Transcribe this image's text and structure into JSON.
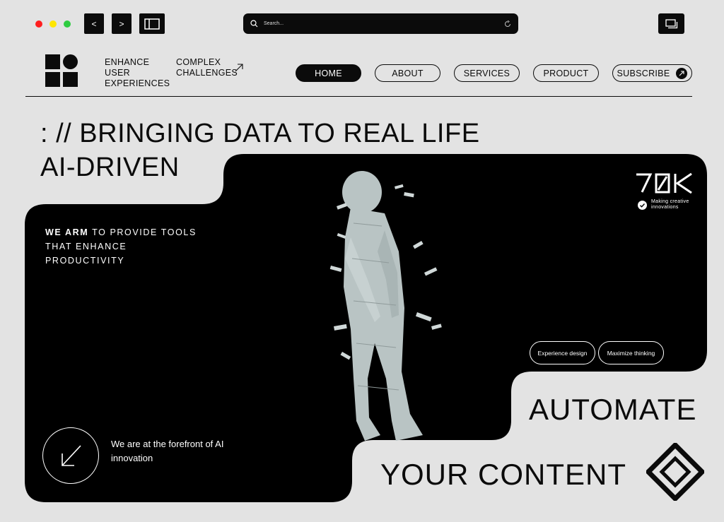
{
  "window": {
    "dots": [
      "#ff1f1f",
      "#ffe600",
      "#2ecc40"
    ],
    "back_label": "<",
    "forward_label": ">",
    "search_placeholder": "Search...",
    "icons": [
      "sidebar-icon",
      "search-icon",
      "reload-icon",
      "tabs-icon"
    ]
  },
  "header": {
    "tagline_1": [
      "ENHANCE",
      "USER",
      "EXPERIENCES"
    ],
    "tagline_2": [
      "COMPLEX",
      "CHALLENGES"
    ],
    "nav": [
      {
        "label": "HOME",
        "active": true
      },
      {
        "label": "ABOUT",
        "active": false
      },
      {
        "label": "SERVICES",
        "active": false
      },
      {
        "label": "PRODUCT",
        "active": false
      },
      {
        "label": "SUBSCRIBE",
        "active": false
      }
    ]
  },
  "hero": {
    "headline_1": ": //  BRINGING DATA TO REAL LIFE",
    "headline_2": "AI-DRIVEN",
    "intro_bold": "WE ARM",
    "intro_rest": " TO PROVIDE TOOLS THAT ENHANCE PRODUCTIVITY",
    "brand_sub": "Making creative innovations",
    "chips": [
      "Experience design",
      "Maximize thinking"
    ],
    "forefront": "We are at the forefront of AI innovation",
    "automate": "AUTOMATE",
    "your_content": "YOUR CONTENT"
  },
  "colors": {
    "ink": "#0b0b0b",
    "page": "#e3e3e3",
    "panel": "#000000"
  }
}
